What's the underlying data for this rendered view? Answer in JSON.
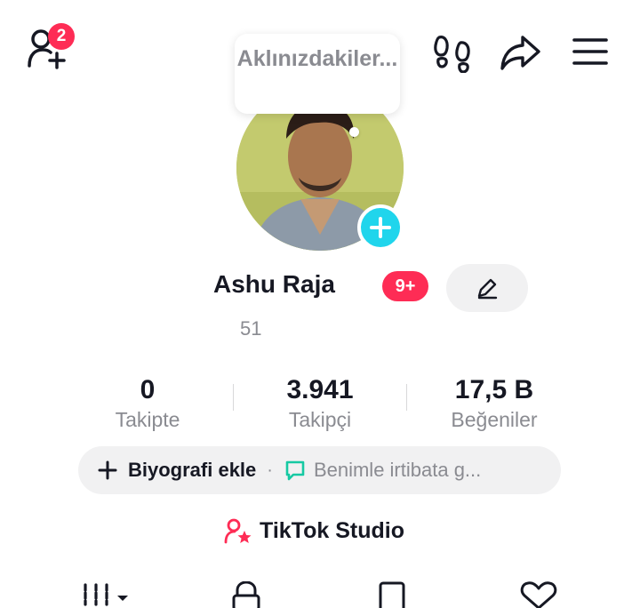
{
  "top_bar": {
    "add_friend_badge": "2",
    "icons": [
      "add-friend-icon",
      "footprint-icon",
      "share-icon",
      "menu-icon"
    ]
  },
  "thought_bubble": {
    "text": "Aklınızdakiler..."
  },
  "profile": {
    "username": "Ashu Raja",
    "notification_badge": "9+",
    "handle": "51",
    "edit_icon": "pencil-icon"
  },
  "stats": [
    {
      "value": "0",
      "label": "Takipte"
    },
    {
      "value": "3.941",
      "label": "Takipçi"
    },
    {
      "value": "17,5 B",
      "label": "Beğeniler"
    }
  ],
  "bio_pill": {
    "add_bio": "Biyografi ekle",
    "separator": "·",
    "contact": "Benimle irtibata g..."
  },
  "studio": {
    "label": "TikTok Studio"
  },
  "tabs": [
    "grid-icon",
    "lock-icon",
    "bookmark-icon",
    "heart-icon"
  ],
  "colors": {
    "accent": "#fe2c55",
    "avatar_add": "#20d5ec",
    "contact_icon": "#16c9a3",
    "pill_bg": "#f1f1f2"
  }
}
